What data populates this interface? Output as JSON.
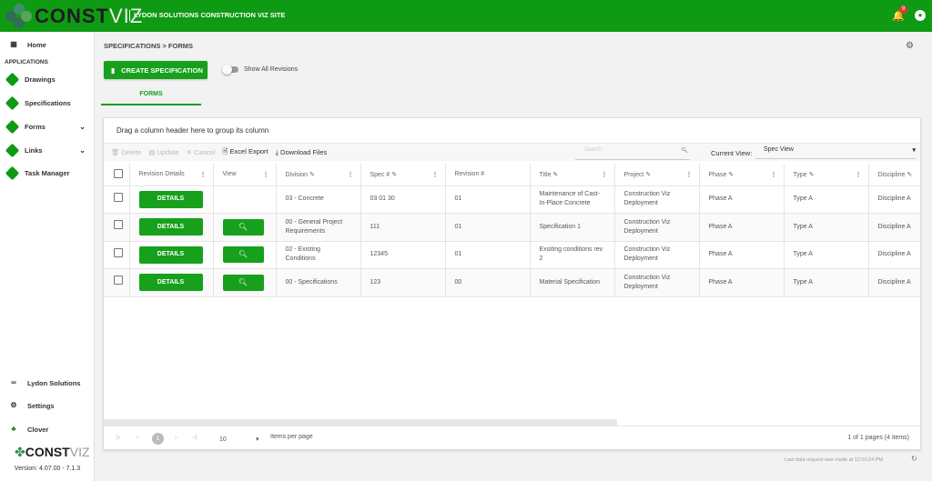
{
  "header": {
    "brand": "CONST",
    "brand_suffix": "VIZ",
    "site": "LYDON SOLUTIONS CONSTRUCTION VIZ SITE",
    "notifications": "9",
    "colors": {
      "brand": "#0f9a14"
    }
  },
  "sidebar": {
    "home": "Home",
    "section": "APPLICATIONS",
    "items": [
      {
        "label": "Drawings"
      },
      {
        "label": "Specifications"
      },
      {
        "label": "Forms"
      },
      {
        "label": "Links"
      },
      {
        "label": "Task Manager"
      }
    ],
    "bottom": [
      {
        "label": "Lydon Solutions"
      },
      {
        "label": "Settings"
      },
      {
        "label": "Clover"
      }
    ],
    "version": "Version: 4.07.00 - 7.1.3"
  },
  "main": {
    "breadcrumb": "SPECIFICATIONS > FORMS",
    "create_label": "CREATE SPECIFICATION",
    "toggle_label": "Show All Revisions",
    "tab": "FORMS"
  },
  "grid": {
    "group_hint": "Drag a column header here to group its column",
    "toolbar": {
      "delete": "Delete",
      "update": "Update",
      "cancel": "Cancel",
      "excel": "Excel Export",
      "download": "Download Files",
      "search_placeholder": "Search",
      "current_view_label": "Current View:",
      "current_view": "Spec View"
    },
    "columns": [
      "Revision Details",
      "View",
      "Division",
      "Spec #",
      "Revision #",
      "Title",
      "Project",
      "Phase",
      "Type",
      "Discipline"
    ],
    "details_label": "DETAILS",
    "rows": [
      {
        "view": false,
        "division": "03 - Concrete",
        "spec": "03 01 30",
        "revision": "01",
        "title": "Maintenance of Cast-In-Place Concrete",
        "project": "Construction Viz Deployment",
        "phase": "Phase A",
        "type": "Type A",
        "discipline": "Discipline A"
      },
      {
        "view": true,
        "division": "00 - General Project Requirements",
        "spec": "111",
        "revision": "01",
        "title": "Specification 1",
        "project": "Construction Viz Deployment",
        "phase": "Phase A",
        "type": "Type A",
        "discipline": "Discipline A"
      },
      {
        "view": true,
        "division": "02 - Existing Conditions",
        "spec": "12345",
        "revision": "01",
        "title": "Exsiting conditions rev 2",
        "project": "Construction Viz Deployment",
        "phase": "Phase A",
        "type": "Type A",
        "discipline": "Discipline A"
      },
      {
        "view": true,
        "division": "00 - Specifications",
        "spec": "123",
        "revision": "00",
        "title": "Material Specification",
        "project": "Construction Viz Deployment",
        "phase": "Phase A",
        "type": "Type A",
        "discipline": "Discipline A"
      }
    ],
    "pager": {
      "page": "1",
      "page_size": "10",
      "items_per_page": "Items per page",
      "info": "1 of 1 pages (4 items)"
    }
  },
  "footer": {
    "last_request": "Last data request was made at 12:01:24 PM"
  }
}
